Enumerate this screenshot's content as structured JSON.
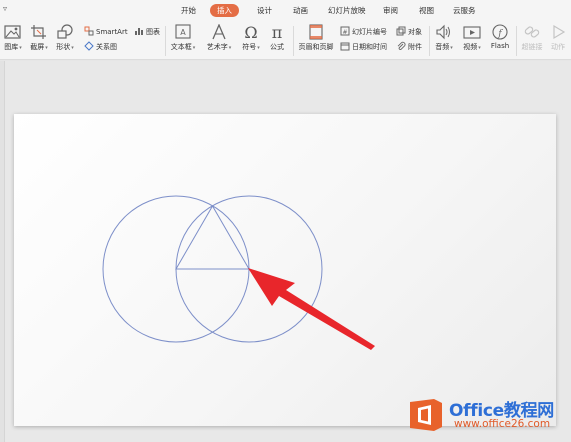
{
  "quick_access_glyph": "▿",
  "tabs": [
    {
      "label": "开始",
      "active": false
    },
    {
      "label": "插入",
      "active": true
    },
    {
      "label": "设计",
      "active": false
    },
    {
      "label": "动画",
      "active": false
    },
    {
      "label": "幻灯片放映",
      "active": false
    },
    {
      "label": "审阅",
      "active": false
    },
    {
      "label": "视图",
      "active": false
    },
    {
      "label": "云服务",
      "active": false
    }
  ],
  "ribbon": {
    "picture": "图库",
    "screenshot": "截屏",
    "shapes": "形状",
    "smartart": "SmartArt",
    "chart": "图表",
    "relation": "关系图",
    "textbox": "文本框",
    "wordart": "艺术字",
    "symbol": "符号",
    "equation": "公式",
    "header_footer": "页眉和页脚",
    "slide_number": "幻灯片编号",
    "object": "对象",
    "date_time": "日期和时间",
    "attachment": "附件",
    "audio": "音频",
    "video": "视频",
    "flash": "Flash",
    "hyperlink": "超链接",
    "action": "动作"
  },
  "colors": {
    "active_tab": "#e46d45",
    "circle_stroke": "#7d8fc9",
    "arrow": "#e8262b",
    "watermark_blue": "#2e6fd6",
    "watermark_orange": "#e05a28"
  },
  "watermark": {
    "title": "Office教程网",
    "url": "www.office26.com"
  }
}
